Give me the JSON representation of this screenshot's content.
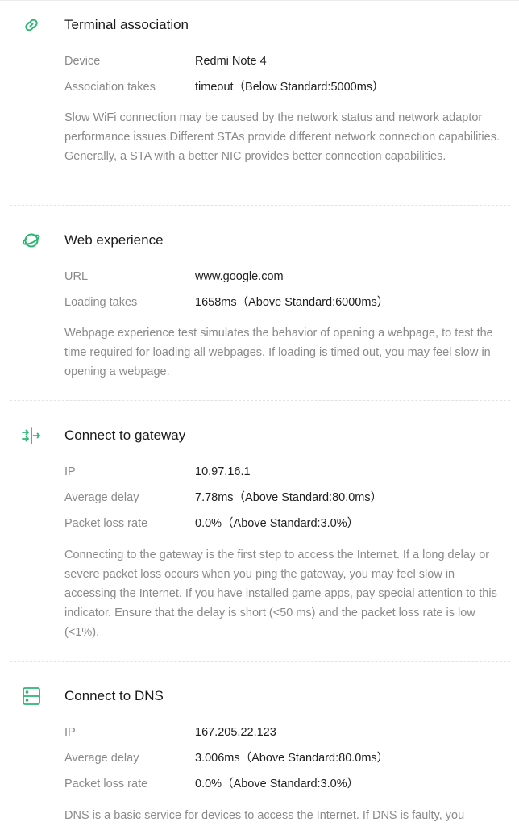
{
  "accent_color": "#2bb673",
  "sections": [
    {
      "icon": "link-icon",
      "title": "Terminal association",
      "rows": [
        {
          "label": "Device",
          "value": "Redmi Note 4"
        },
        {
          "label": "Association takes",
          "value": "timeout（Below Standard:5000ms）"
        }
      ],
      "description": "Slow WiFi connection may be caused by the network status and network adaptor performance issues.Different STAs provide different network connection capabilities.\n Generally, a STA with a better NIC provides better connection capabilities."
    },
    {
      "icon": "planet-icon",
      "title": "Web experience",
      "rows": [
        {
          "label": "URL",
          "value": "www.google.com"
        },
        {
          "label": "Loading takes",
          "value": "1658ms（Above Standard:6000ms）"
        }
      ],
      "description": "Webpage experience test simulates the behavior of opening a webpage, to test the time required for loading all webpages. If loading is timed out, you may feel slow in opening a webpage."
    },
    {
      "icon": "gateway-icon",
      "title": "Connect to gateway",
      "rows": [
        {
          "label": "IP",
          "value": "10.97.16.1"
        },
        {
          "label": "Average delay",
          "value": "7.78ms（Above Standard:80.0ms）"
        },
        {
          "label": "Packet loss rate",
          "value": "0.0%（Above Standard:3.0%）"
        }
      ],
      "description": "Connecting to the gateway is the first step to access the Internet. If a long delay or severe packet loss occurs when you ping the gateway, you may feel slow in accessing the Internet. If you have installed game apps, pay special attention to this indicator. Ensure that the delay is short (<50 ms) and the packet loss rate is low (<1%)."
    },
    {
      "icon": "dns-server-icon",
      "title": "Connect to DNS",
      "rows": [
        {
          "label": "IP",
          "value": "167.205.22.123"
        },
        {
          "label": "Average delay",
          "value": "3.006ms（Above Standard:80.0ms）"
        },
        {
          "label": "Packet loss rate",
          "value": "0.0%（Above Standard:3.0%）"
        }
      ],
      "description": "DNS is a basic service for devices to access the Internet. If DNS is faulty, you"
    }
  ]
}
